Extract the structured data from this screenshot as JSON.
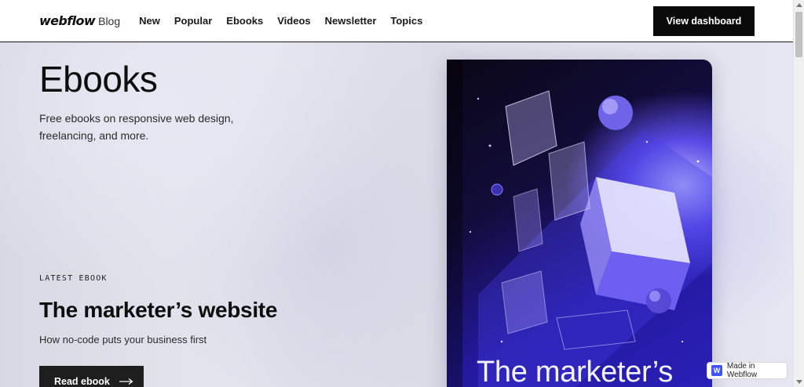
{
  "nav": {
    "brand": "webflow",
    "brand_sub": "Blog",
    "links": [
      "New",
      "Popular",
      "Ebooks",
      "Videos",
      "Newsletter",
      "Topics"
    ],
    "cta": "View dashboard"
  },
  "hero": {
    "title": "Ebooks",
    "description": "Free ebooks on responsive web design, freelancing, and more.",
    "eyebrow": "LATEST EBOOK",
    "latest_title": "The marketer’s website",
    "latest_subtitle": "How no-code puts your business first",
    "read_button": "Read ebook"
  },
  "cover": {
    "title": "The marketer’s"
  },
  "badge": {
    "icon_letter": "W",
    "label": "Made in Webflow"
  },
  "colors": {
    "cta_bg": "#0a0a0a",
    "cover_accent": "#2a20b8",
    "badge_icon": "#4353ff"
  }
}
